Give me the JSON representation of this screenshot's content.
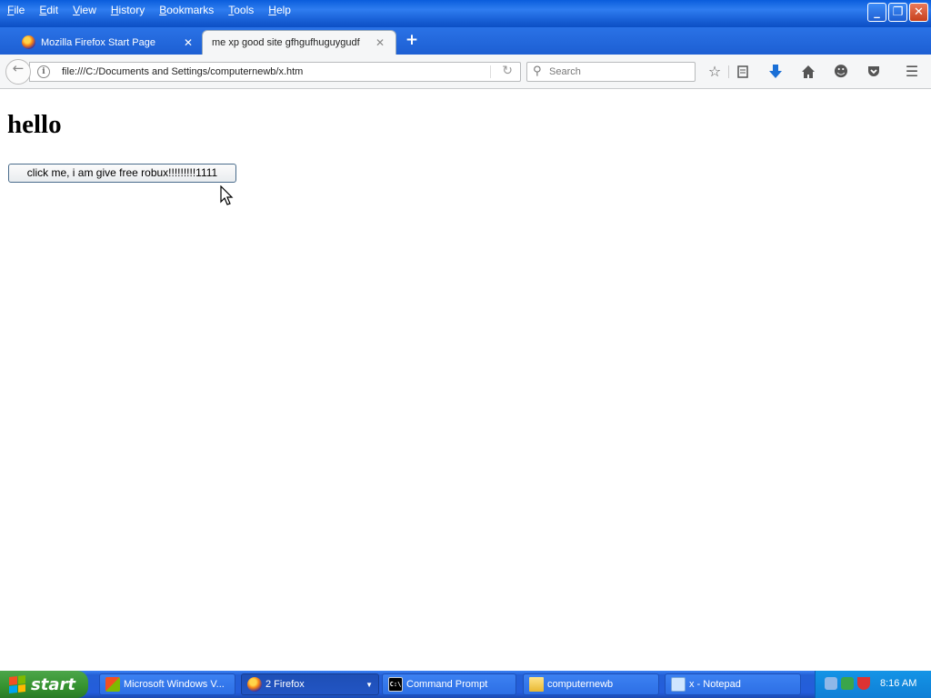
{
  "menu": [
    "File",
    "Edit",
    "View",
    "History",
    "Bookmarks",
    "Tools",
    "Help"
  ],
  "tabs": [
    {
      "label": "Mozilla Firefox Start Page"
    },
    {
      "label": "me xp good site gfhgufhuguygudf"
    }
  ],
  "navbar": {
    "url": "file:///C:/Documents and Settings/computernewb/x.htm",
    "search_placeholder": "Search"
  },
  "page": {
    "heading": "hello",
    "button_label": "click me, i am give free robux!!!!!!!!!1111"
  },
  "taskbar": {
    "start_label": "start",
    "tasks": [
      {
        "label": "Microsoft Windows V..."
      },
      {
        "label": "2 Firefox"
      },
      {
        "label": "Command Prompt"
      },
      {
        "label": "computernewb"
      },
      {
        "label": "x - Notepad"
      }
    ],
    "clock": "8:16 AM"
  },
  "colors": {
    "titlebar_blue": "#1a62d8",
    "taskbar_blue": "#245ddb",
    "start_green": "#35922f",
    "tray_blue": "#0f7fd6"
  }
}
